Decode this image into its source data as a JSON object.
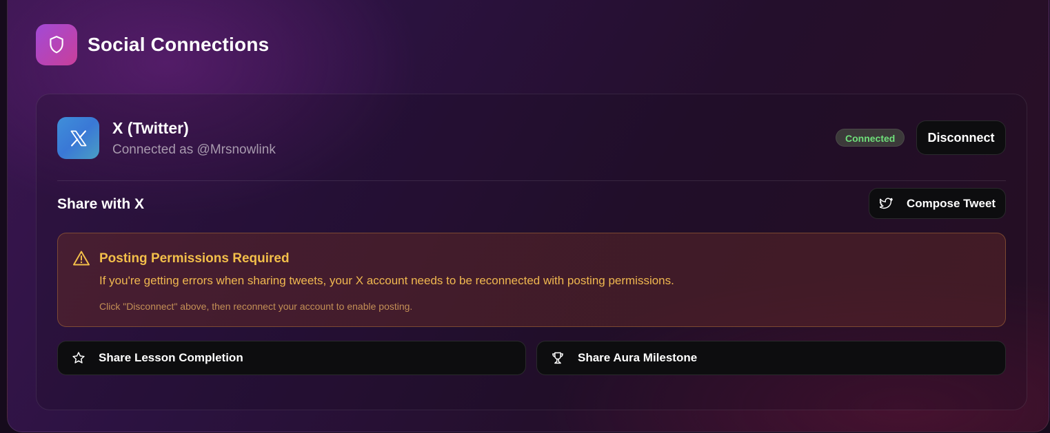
{
  "header": {
    "title": "Social Connections",
    "icon": "shield-icon"
  },
  "account": {
    "platform_name": "X (Twitter)",
    "connected_as": "Connected as @Mrsnowlink",
    "status": "Connected",
    "disconnect_label": "Disconnect",
    "logo_icon": "x-logo-icon"
  },
  "share": {
    "section_title": "Share with X",
    "compose_label": "Compose Tweet",
    "compose_icon": "twitter-bird-icon"
  },
  "warning": {
    "title": "Posting Permissions Required",
    "body": "If you're getting errors when sharing tweets, your X account needs to be reconnected with posting permissions.",
    "note": "Click \"Disconnect\" above, then reconnect your account to enable posting.",
    "icon": "warning-triangle-icon"
  },
  "actions": [
    {
      "label": "Share Lesson Completion",
      "icon": "star-icon"
    },
    {
      "label": "Share Aura Milestone",
      "icon": "trophy-icon"
    }
  ],
  "colors": {
    "accent_gradient_start": "#a24ad6",
    "accent_gradient_end": "#c93f9a",
    "connected_green": "#6fe07a",
    "warning_amber": "#f3bf4a"
  }
}
